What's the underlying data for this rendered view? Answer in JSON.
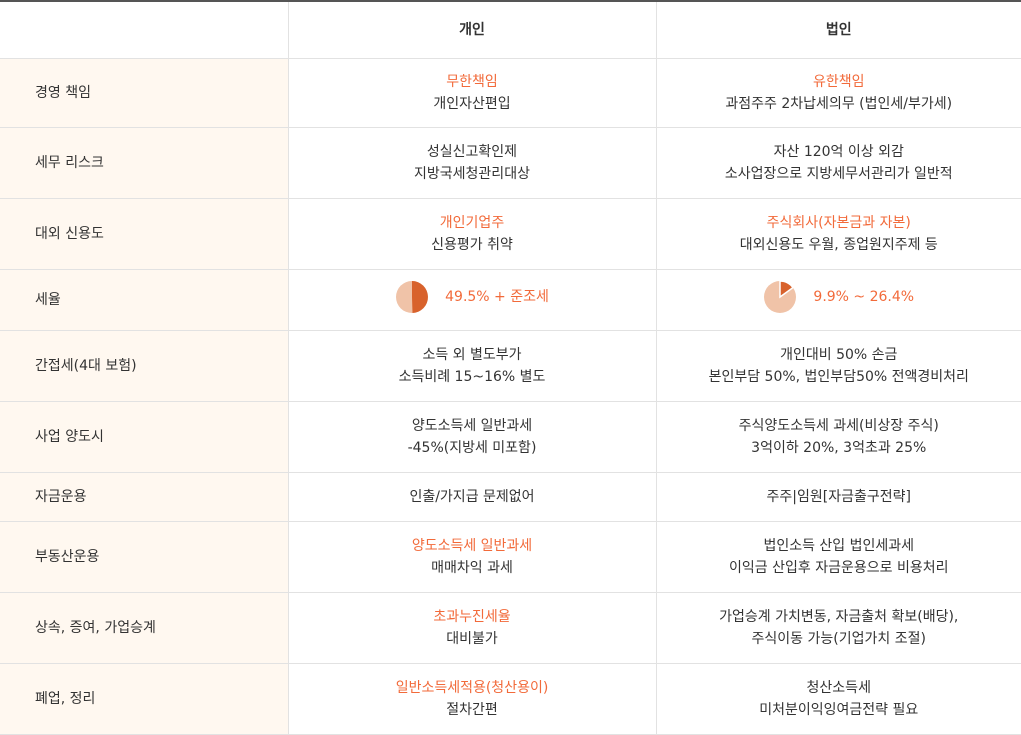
{
  "header": {
    "col1": "",
    "col2": "개인",
    "col3": "법인"
  },
  "colors": {
    "accent": "#f26a3a",
    "label_bg": "#fff8f0",
    "pie_light": "#f0c3a8",
    "pie_dark": "#d8622c"
  },
  "rows": [
    {
      "label": "경영 책임",
      "personal": {
        "line1": "무한책임",
        "line2": "개인자산편입"
      },
      "corporate": {
        "line1": "유한책임",
        "line2": "과점주주 2차납세의무 (법인세/부가세)"
      }
    },
    {
      "label": "세무 리스크",
      "personal": {
        "line1": "성실신고확인제",
        "line2": "지방국세청관리대상"
      },
      "corporate": {
        "line1": "자산 120억 이상 외감",
        "line2": "소사업장으로 지방세무서관리가 일반적"
      }
    },
    {
      "label": "대외 신용도",
      "personal": {
        "line1": "개인기업주",
        "line2": "신용평가 취약"
      },
      "corporate": {
        "line1": "주식회사(자본금과 자본)",
        "line2": "대외신용도 우월, 종업원지주제 등"
      }
    },
    {
      "label": "세율",
      "personal": {
        "text": "49.5% + 준조세",
        "pie_fraction": 0.495
      },
      "corporate": {
        "text": "9.9% ~ 26.4%",
        "pie_fraction": 0.15
      }
    },
    {
      "label": "간접세(4대 보험)",
      "personal": {
        "line1": "소득 외 별도부가",
        "line2": "소득비례 15~16% 별도"
      },
      "corporate": {
        "line1": "개인대비 50% 손금",
        "line2": "본인부담 50%, 법인부담50% 전액경비처리"
      }
    },
    {
      "label": "사업 양도시",
      "personal": {
        "line1": "양도소득세 일반과세",
        "line2": "-45%(지방세 미포함)"
      },
      "corporate": {
        "line1": "주식양도소득세 과세(비상장 주식)",
        "line2": "3억이하 20%, 3억초과 25%"
      }
    },
    {
      "label": "자금운용",
      "personal": {
        "line1": "인출/가지급 문제없어"
      },
      "corporate": {
        "line1": "주주|임원[자금출구전략]"
      }
    },
    {
      "label": "부동산운용",
      "personal": {
        "line1": "양도소득세 일반과세",
        "line2": "매매차익 과세"
      },
      "corporate": {
        "line1": "법인소득 산입 법인세과세",
        "line2": "이익금 산입후 자금운용으로 비용처리"
      }
    },
    {
      "label": "상속, 증여, 가업승계",
      "personal": {
        "line1": "초과누진세율",
        "line2": "대비불가"
      },
      "corporate": {
        "line1": "가업승계 가치변동, 자금출처 확보(배당),",
        "line2": "주식이동 가능(기업가치 조절)"
      }
    },
    {
      "label": "폐업, 정리",
      "personal": {
        "line1": "일반소득세적용(청산용이)",
        "line2": "절차간편"
      },
      "corporate": {
        "line1": "청산소득세",
        "line2": "미처분이익잉여금전략 필요"
      }
    }
  ]
}
